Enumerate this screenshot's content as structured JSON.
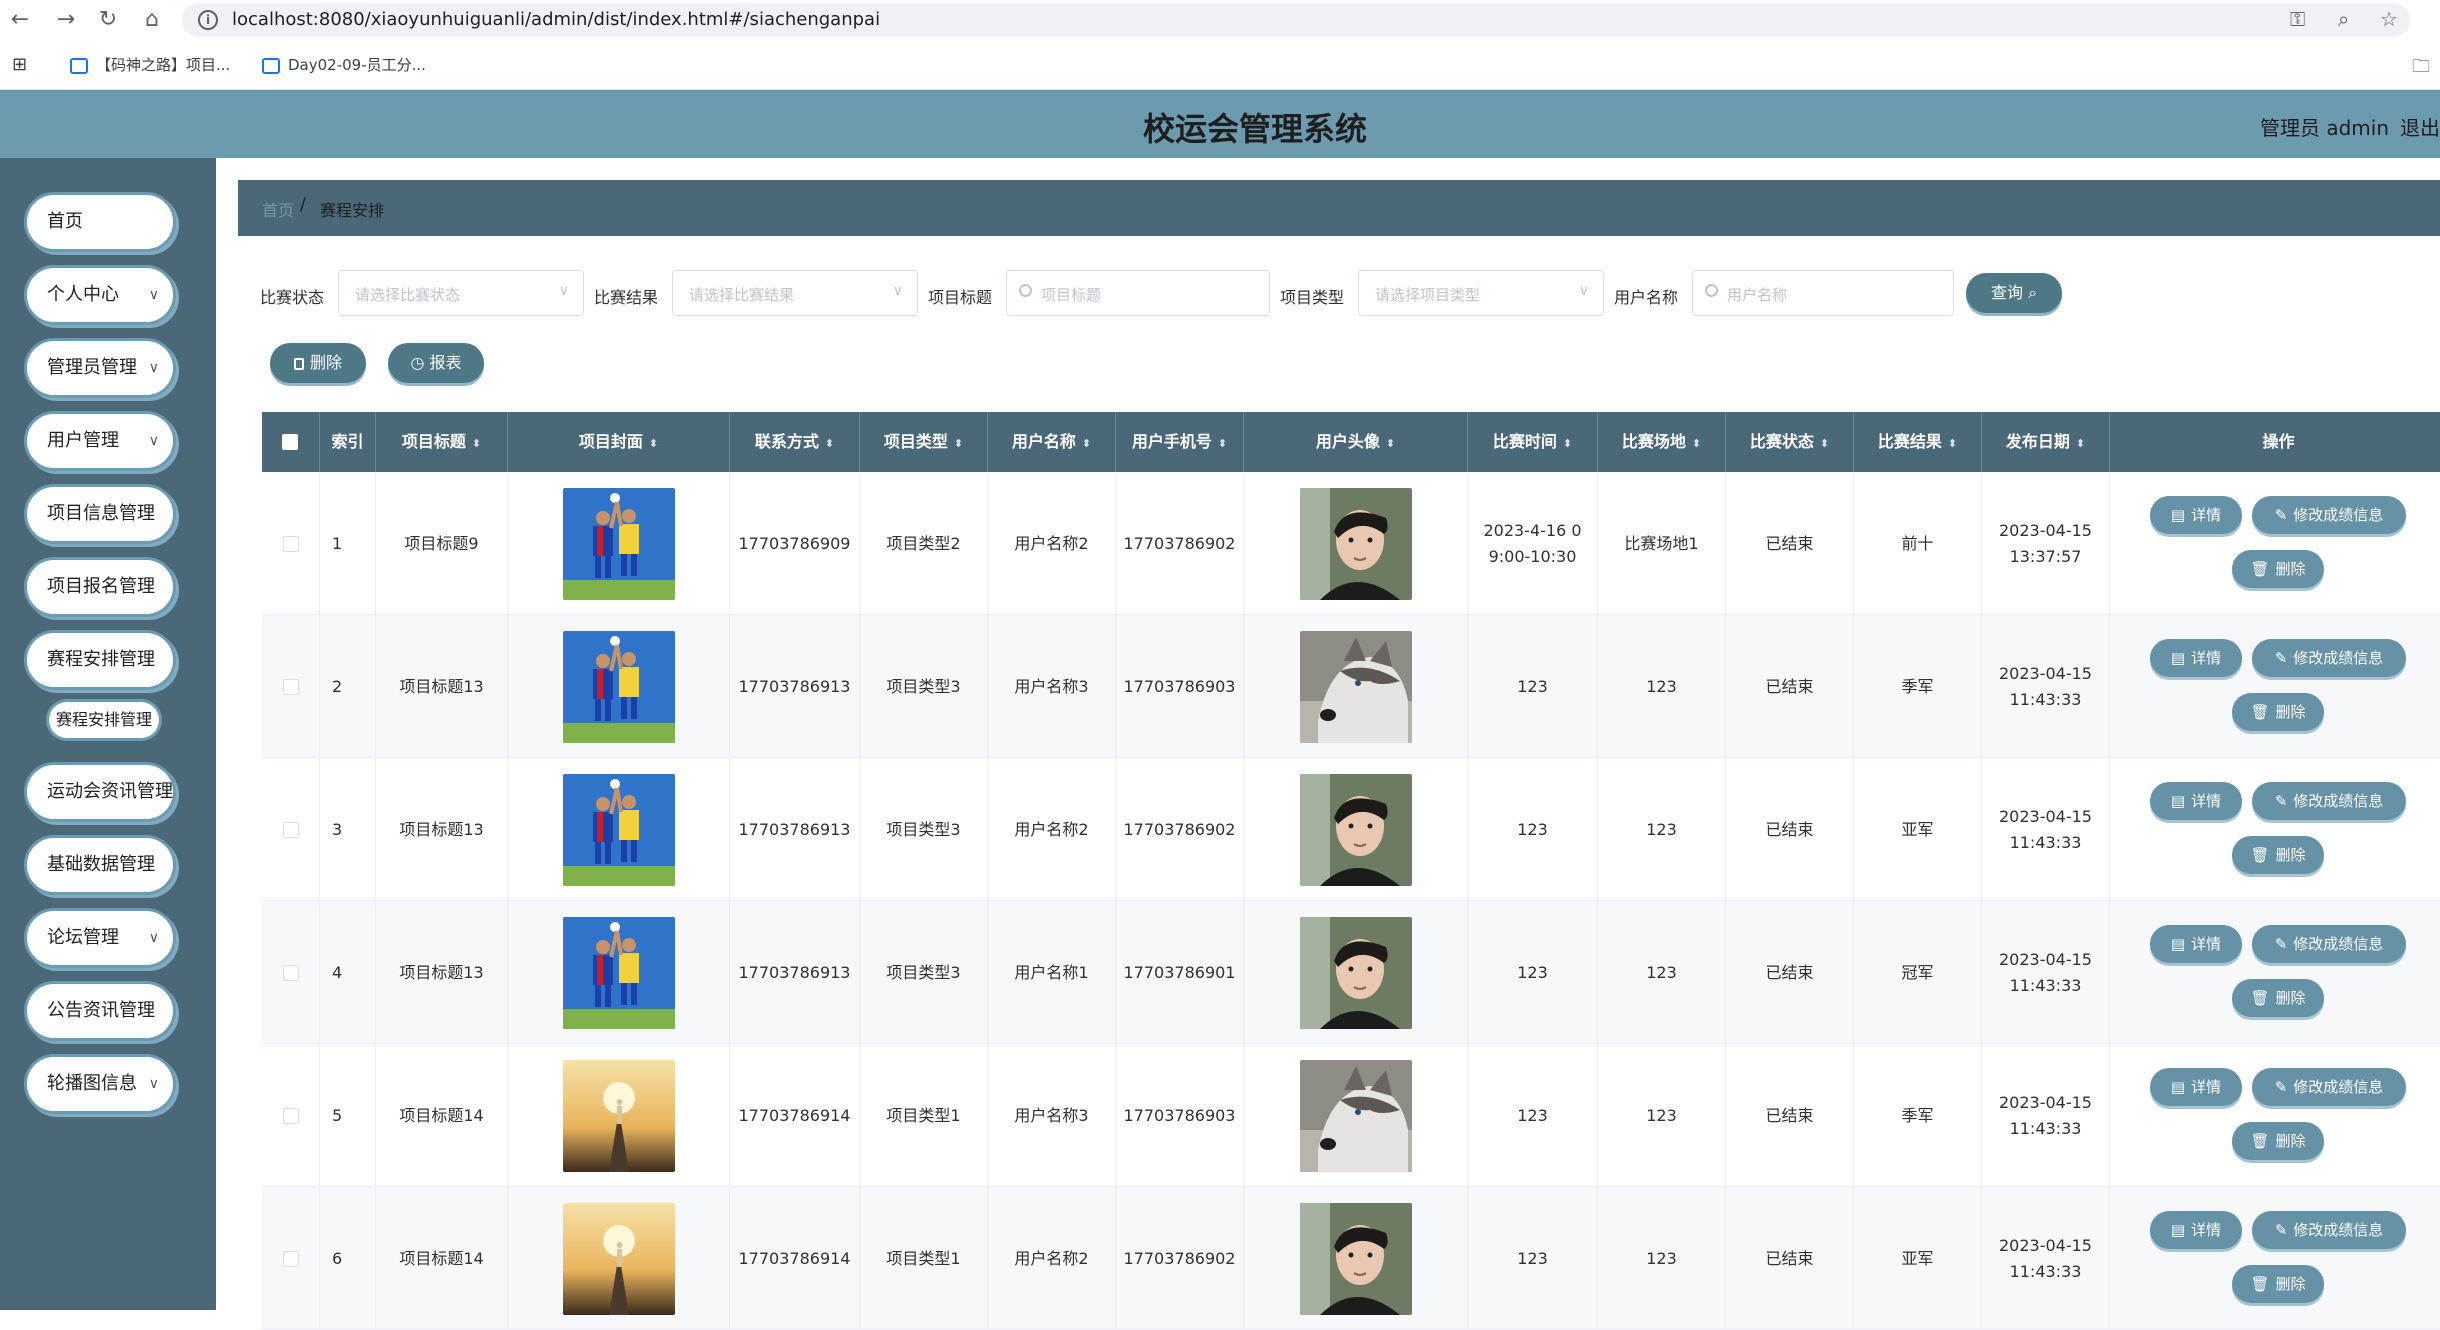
{
  "browser": {
    "url": "localhost:8080/xiaoyunhuiguanli/admin/dist/index.html#/siachenganpai",
    "bookmarks": [
      "【码神之路】项目...",
      "Day02-09-员工分..."
    ]
  },
  "header": {
    "title": "校运会管理系统",
    "admin_label": "管理员 admin",
    "logout_label": "退出登录"
  },
  "sidebar": {
    "items": [
      {
        "label": "首页"
      },
      {
        "label": "个人中心"
      },
      {
        "label": "管理员管理"
      },
      {
        "label": "用户管理"
      },
      {
        "label": "项目信息管理"
      },
      {
        "label": "项目报名管理"
      },
      {
        "label": "赛程安排管理"
      },
      {
        "label": "运动会资讯管理"
      },
      {
        "label": "基础数据管理"
      },
      {
        "label": "论坛管理"
      },
      {
        "label": "公告资讯管理"
      },
      {
        "label": "轮播图信息"
      }
    ],
    "sub_item": "赛程安排管理"
  },
  "breadcrumb": {
    "home": "首页",
    "separator": "/",
    "current": "赛程安排"
  },
  "filters": {
    "status_label": "比赛状态",
    "status_placeholder": "请选择比赛状态",
    "result_label": "比赛结果",
    "result_placeholder": "请选择比赛结果",
    "title_label": "项目标题",
    "title_placeholder": "项目标题",
    "type_label": "项目类型",
    "type_placeholder": "请选择项目类型",
    "user_label": "用户名称",
    "user_placeholder": "用户名称",
    "query_button": "查询"
  },
  "toolbar": {
    "delete_button": "删除",
    "report_button": "报表"
  },
  "table": {
    "headers": [
      "索引",
      "项目标题",
      "项目封面",
      "联系方式",
      "项目类型",
      "用户名称",
      "用户手机号",
      "用户头像",
      "比赛时间",
      "比赛场地",
      "比赛状态",
      "比赛结果",
      "发布日期",
      "操作"
    ],
    "actions": {
      "detail": "详情",
      "edit": "修改成绩信息",
      "delete": "删除"
    },
    "rows": [
      {
        "index": "1",
        "title": "项目标题9",
        "cover": "soccer",
        "contact": "17703786909",
        "type": "项目类型2",
        "user": "用户名称2",
        "phone": "17703786902",
        "avatar": "man",
        "time": "2023-4-16 09:00-10:30",
        "venue": "比赛场地1",
        "status": "已结束",
        "result": "前十",
        "date": "2023-04-15 13:37:57"
      },
      {
        "index": "2",
        "title": "项目标题13",
        "cover": "soccer",
        "contact": "17703786913",
        "type": "项目类型3",
        "user": "用户名称3",
        "phone": "17703786903",
        "avatar": "husky",
        "time": "123",
        "venue": "123",
        "status": "已结束",
        "result": "季军",
        "date": "2023-04-15 11:43:33"
      },
      {
        "index": "3",
        "title": "项目标题13",
        "cover": "soccer",
        "contact": "17703786913",
        "type": "项目类型3",
        "user": "用户名称2",
        "phone": "17703786902",
        "avatar": "man",
        "time": "123",
        "venue": "123",
        "status": "已结束",
        "result": "亚军",
        "date": "2023-04-15 11:43:33"
      },
      {
        "index": "4",
        "title": "项目标题13",
        "cover": "soccer",
        "contact": "17703786913",
        "type": "项目类型3",
        "user": "用户名称1",
        "phone": "17703786901",
        "avatar": "man",
        "time": "123",
        "venue": "123",
        "status": "已结束",
        "result": "冠军",
        "date": "2023-04-15 11:43:33"
      },
      {
        "index": "5",
        "title": "项目标题14",
        "cover": "runner",
        "contact": "17703786914",
        "type": "项目类型1",
        "user": "用户名称3",
        "phone": "17703786903",
        "avatar": "husky",
        "time": "123",
        "venue": "123",
        "status": "已结束",
        "result": "季军",
        "date": "2023-04-15 11:43:33"
      },
      {
        "index": "6",
        "title": "项目标题14",
        "cover": "runner",
        "contact": "17703786914",
        "type": "项目类型1",
        "user": "用户名称2",
        "phone": "17703786902",
        "avatar": "man",
        "time": "123",
        "venue": "123",
        "status": "已结束",
        "result": "亚军",
        "date": "2023-04-15 11:43:33"
      }
    ]
  },
  "colors": {
    "header": "#6c9aae",
    "sidebar": "#4a6877",
    "button": "#4f7887"
  }
}
